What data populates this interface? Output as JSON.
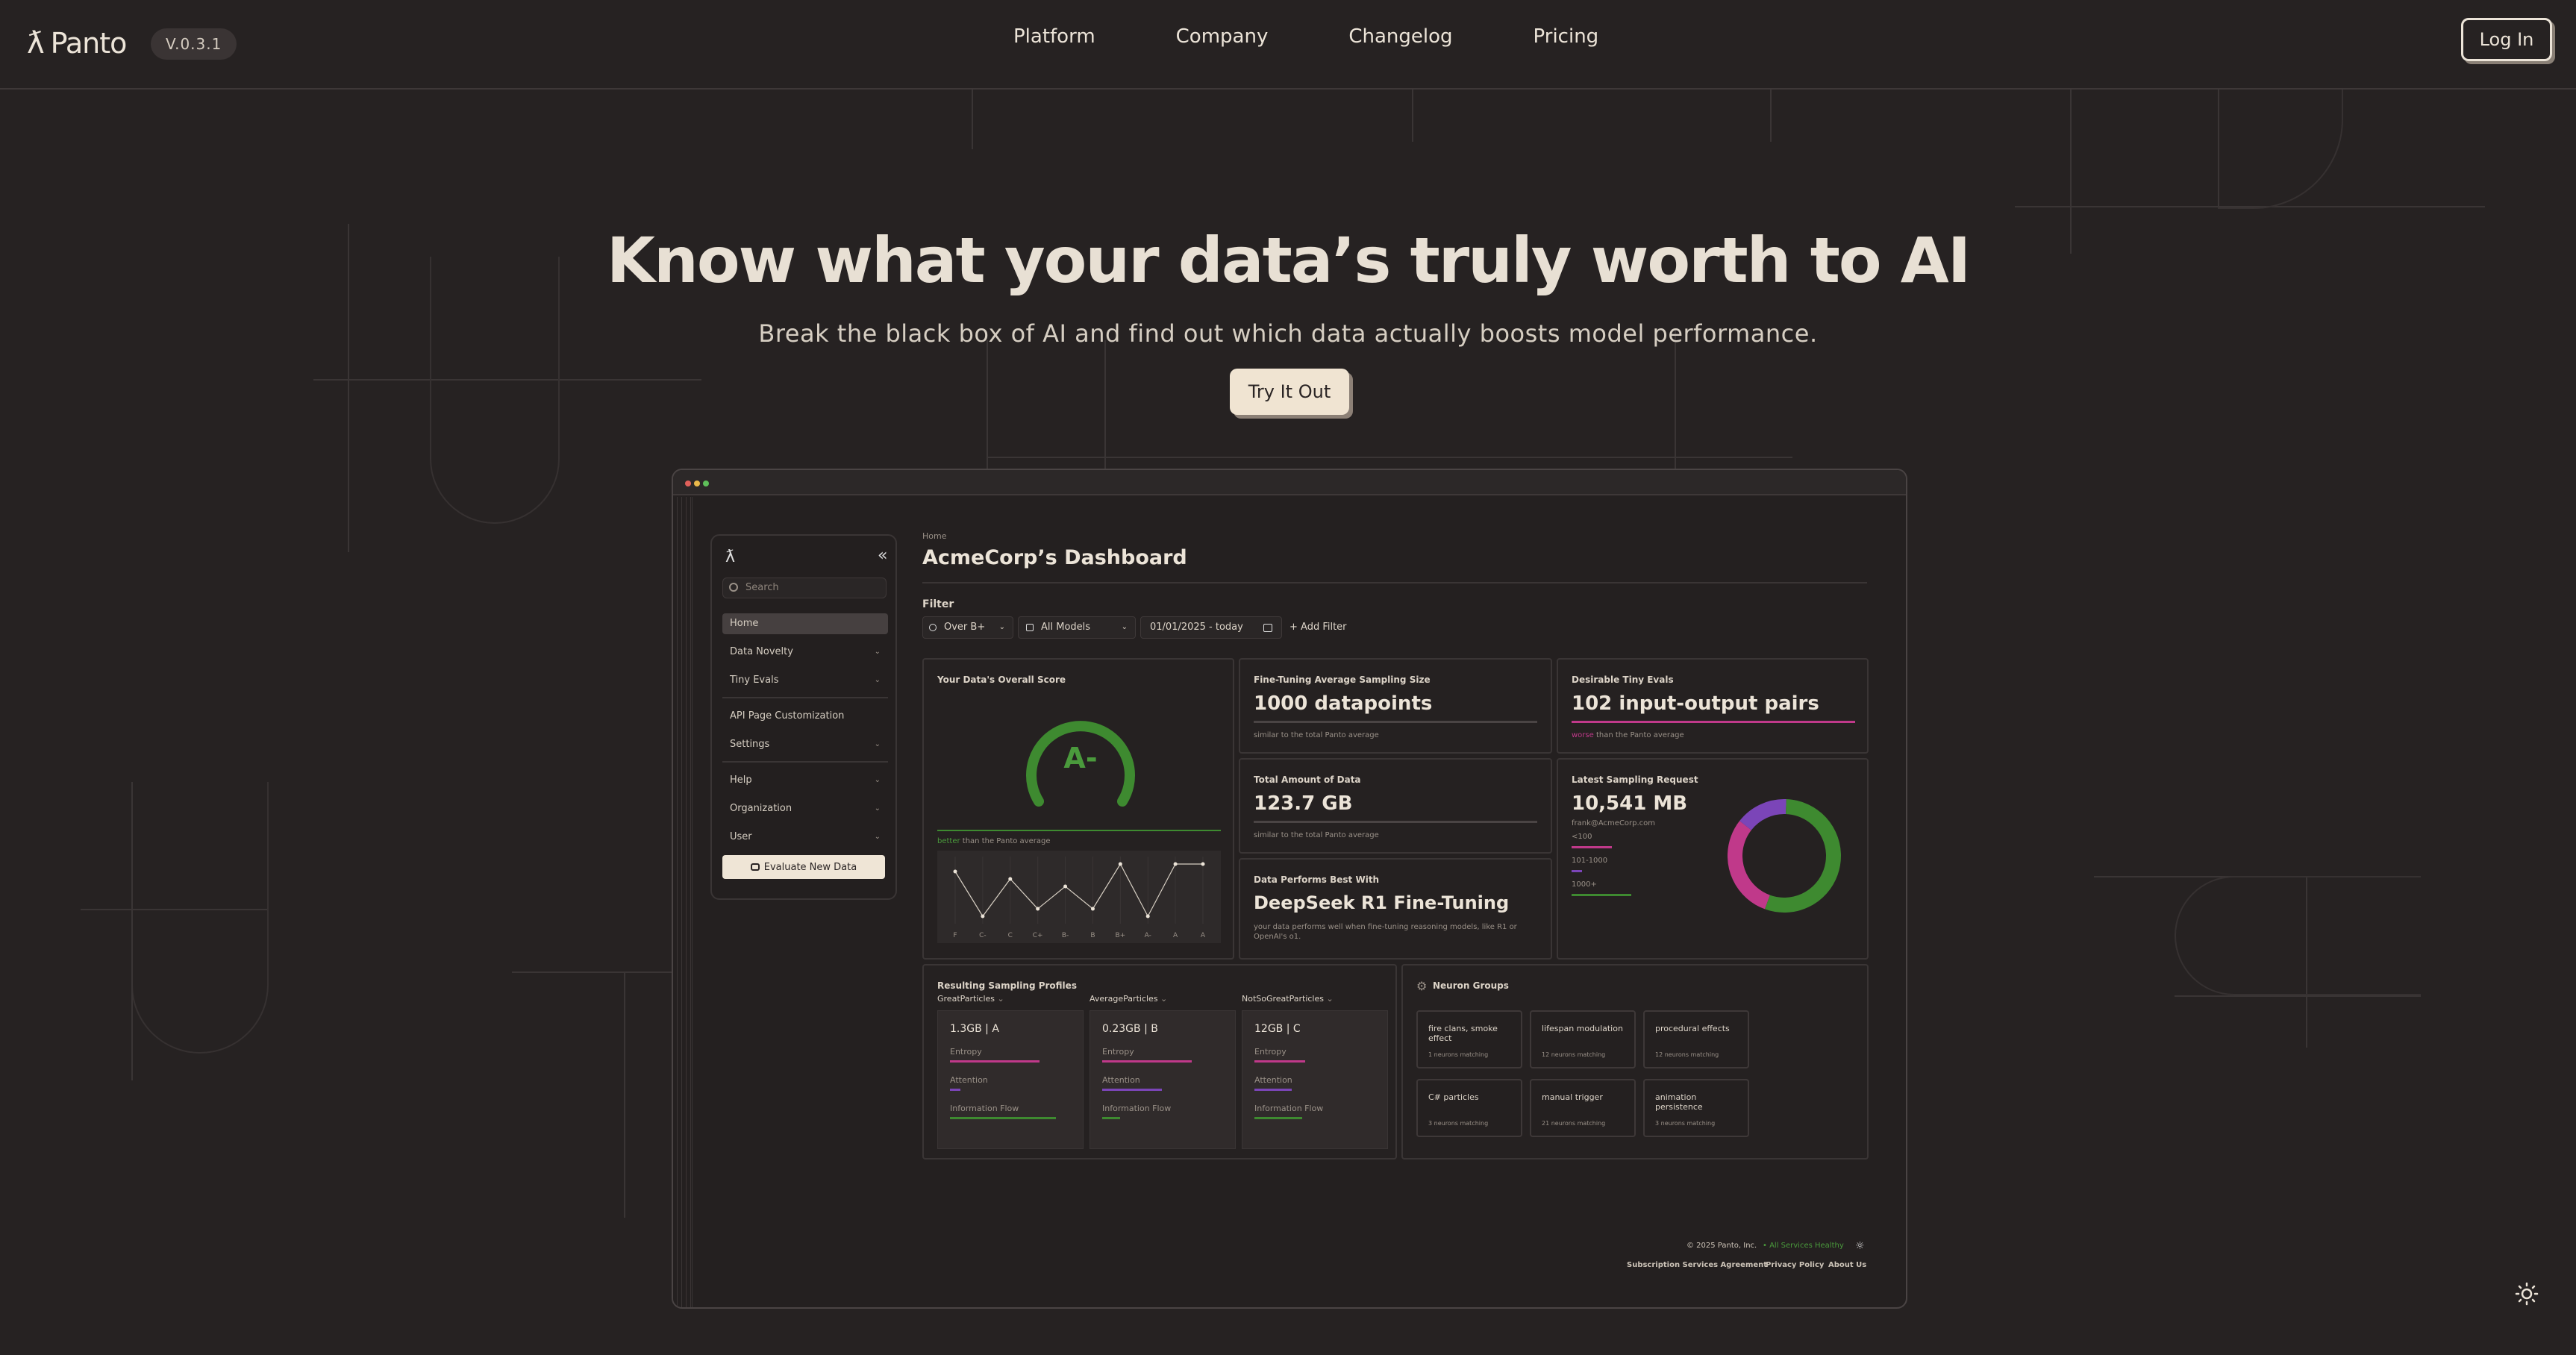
{
  "nav": {
    "logo": "Panto",
    "version": "V.0.3.1",
    "links": [
      "Platform",
      "Company",
      "Changelog",
      "Pricing"
    ],
    "login": "Log In"
  },
  "hero": {
    "title": "Know what your data’s truly worth to AI",
    "subtitle": "Break the black box of AI and find out which data actually boosts model performance.",
    "cta": "Try It Out"
  },
  "dashboard": {
    "sidebar": {
      "search_placeholder": "Search",
      "items": [
        "Home",
        "Data Novelty",
        "Tiny Evals",
        "API Page Customization",
        "Settings",
        "Help",
        "Organization",
        "User"
      ],
      "evaluate": "Evaluate New Data"
    },
    "breadcrumb": "Home",
    "title": "AcmeCorp’s Dashboard",
    "filter": {
      "label": "Filter",
      "over": "Over B+",
      "models": "All Models",
      "date": "01/01/2025 - today",
      "add": "+ Add Filter"
    },
    "score": {
      "title": "Your Data's Overall Score",
      "grade": "A-",
      "better": "better",
      "note": "than the Panto average",
      "grades": [
        "F",
        "C-",
        "C",
        "C+",
        "B-",
        "B",
        "B+",
        "A-",
        "A",
        "A"
      ],
      "line_values": [
        7,
        1,
        6,
        2,
        5,
        2,
        8,
        1,
        8,
        8
      ]
    },
    "sampling": {
      "title": "Fine-Tuning Average Sampling Size",
      "value": "1000 datapoints",
      "note": "similar to the total Panto average"
    },
    "tiny_evals": {
      "title": "Desirable Tiny Evals",
      "value": "102 input-output pairs",
      "worse": "worse",
      "note": "than the Panto average"
    },
    "total_data": {
      "title": "Total Amount of Data",
      "value": "123.7 GB",
      "note": "similar to the total Panto average"
    },
    "latest": {
      "title": "Latest Sampling Request",
      "value": "10,541 MB",
      "email": "frank@AcmeCorp.com",
      "ranges": [
        "<100",
        "101-1000",
        "1000+"
      ],
      "donut": [
        {
          "label": "<100",
          "value": 30,
          "color": "#c0398a"
        },
        {
          "label": "101-1000",
          "value": 15,
          "color": "#7b45b8"
        },
        {
          "label": "1000+",
          "value": 55,
          "color": "#3e8a30"
        }
      ]
    },
    "best": {
      "title": "Data Performs Best With",
      "value": "DeepSeek R1 Fine-Tuning",
      "note": "your data performs well when fine-tuning reasoning models, like R1 or OpenAI's o1."
    },
    "profiles": {
      "title": "Resulting Sampling Profiles",
      "items": [
        {
          "label": "GreatParticles",
          "head": "1.3GB | A"
        },
        {
          "label": "AverageParticles",
          "head": "0.23GB | B"
        },
        {
          "label": "NotSoGreatParticles",
          "head": "12GB | C"
        }
      ],
      "metrics": [
        "Entropy",
        "Attention",
        "Information Flow"
      ]
    },
    "neurons": {
      "title": "Neuron Groups",
      "items": [
        {
          "name": "fire clans, smoke effect",
          "count": "1 neurons matching"
        },
        {
          "name": "lifespan modulation",
          "count": "12 neurons matching"
        },
        {
          "name": "procedural effects",
          "count": "12 neurons matching"
        },
        {
          "name": "C# particles",
          "count": "3 neurons matching"
        },
        {
          "name": "manual trigger",
          "count": "21 neurons matching"
        },
        {
          "name": "animation persistence",
          "count": "3 neurons matching"
        }
      ]
    },
    "footer": {
      "copyright": "© 2025 Panto, Inc.",
      "status": "• All Services Healthy",
      "links": [
        "Subscription Services Agreement",
        "Privacy Policy",
        "About Us"
      ]
    }
  },
  "colors": {
    "background": "#262222",
    "text": "#ece4d8",
    "accent_green": "#4a9a3c",
    "accent_pink": "#c0398a",
    "accent_purple": "#7b45b8"
  }
}
